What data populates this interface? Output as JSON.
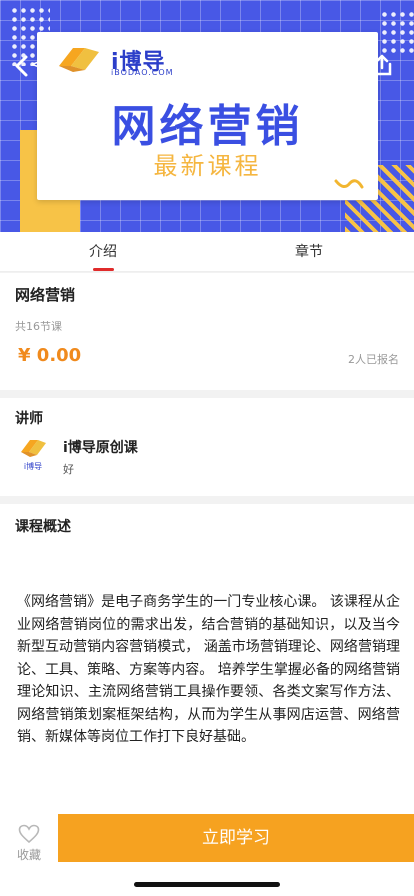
{
  "banner": {
    "logo_text": "i博导",
    "logo_sub": "iBODAO.COM",
    "title": "网络营销",
    "subtitle": "最新课程"
  },
  "nav": {
    "back_extra": "<",
    "icons": {
      "back": "back-arrow-icon",
      "share": "share-icon"
    }
  },
  "tabs": [
    {
      "label": "介绍",
      "active": true
    },
    {
      "label": "章节",
      "active": false
    }
  ],
  "course": {
    "name": "网络营销",
    "lesson_count": "共16节课",
    "price": "¥ 0.00",
    "enrolled": "2人已报名"
  },
  "lecturer": {
    "section_title": "讲师",
    "name": "i博导原创课",
    "description": "好",
    "avatar_text": "i博导"
  },
  "overview": {
    "section_title": "课程概述",
    "text": "《网络营销》是电子商务学生的一门专业核心课。 该课程从企业网络营销岗位的需求出发，结合营销的基础知识，以及当今新型互动营销内容营销模式， 涵盖市场营销理论、网络营销理论、工具、策略、方案等内容。 培养学生掌握必备的网络营销理论知识、主流网络营销工具操作要领、各类文案写作方法、网络营销策划案框架结构，从而为学生从事网店运营、网络营销、新媒体等岗位工作打下良好基础。"
  },
  "bottom_bar": {
    "favorite_label": "收藏",
    "study_button": "立即学习"
  },
  "colors": {
    "accent_orange": "#f6a220",
    "price_orange": "#f08a1d",
    "tab_underline": "#e02b2b",
    "banner_blue": "#4858e6"
  }
}
